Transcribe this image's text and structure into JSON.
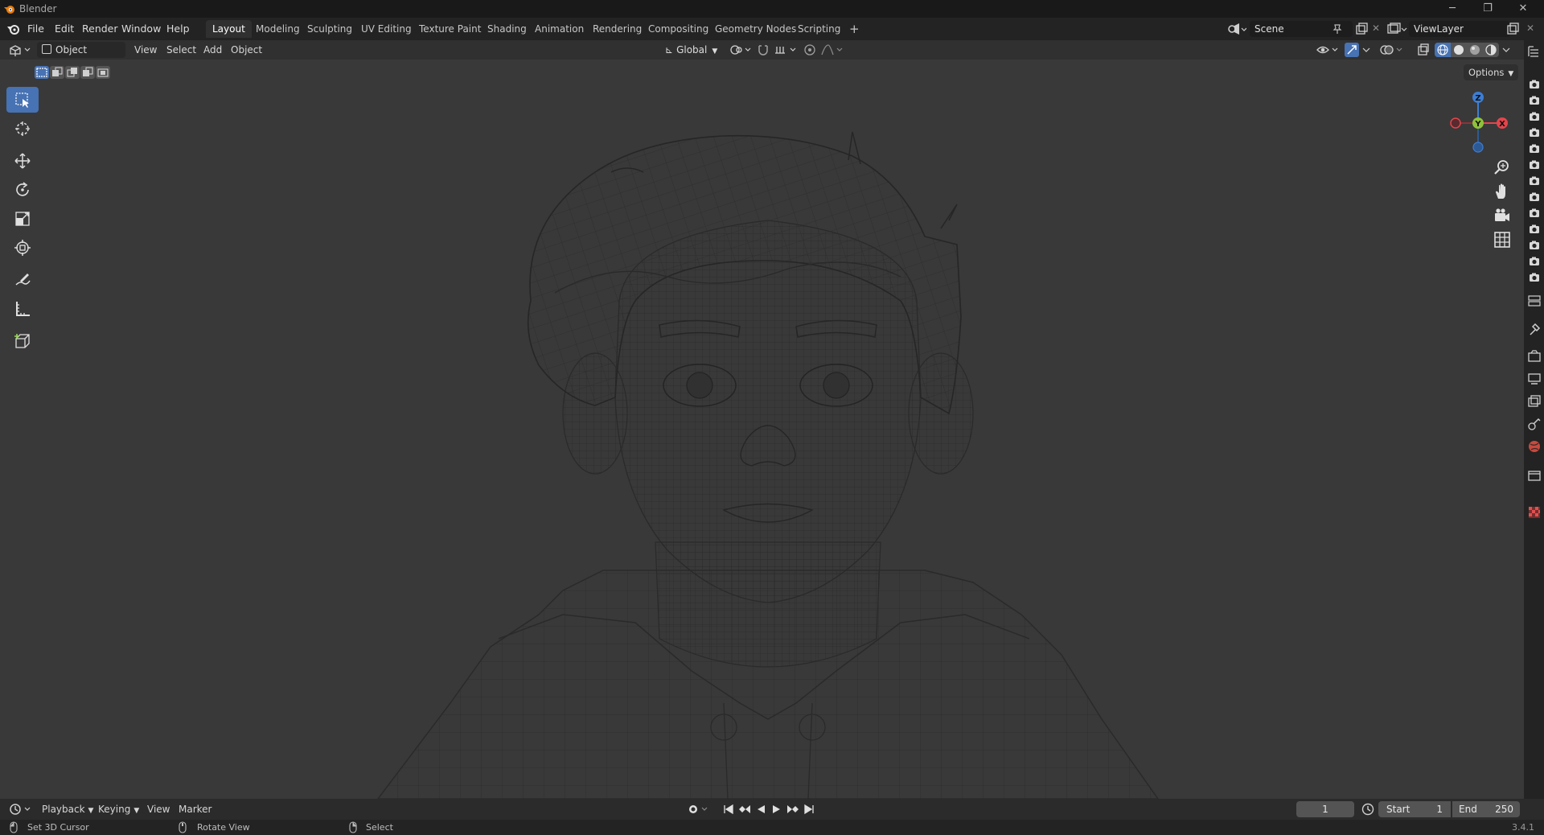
{
  "window": {
    "title": "Blender",
    "controls": [
      "minimize-icon",
      "restore-icon",
      "close-icon"
    ]
  },
  "menu": {
    "items": [
      "File",
      "Edit",
      "Render",
      "Window",
      "Help"
    ]
  },
  "workspaces": {
    "tabs": [
      "Layout",
      "Modeling",
      "Sculpting",
      "UV Editing",
      "Texture Paint",
      "Shading",
      "Animation",
      "Rendering",
      "Compositing",
      "Geometry Nodes",
      "Scripting"
    ],
    "active": "Layout",
    "add_label": "+"
  },
  "scene": {
    "name": "Scene",
    "view_layer": "ViewLayer"
  },
  "viewport_header": {
    "mode": "Object Mode",
    "menus": [
      "View",
      "Select",
      "Add",
      "Object"
    ],
    "orientation": "Global",
    "options_label": "Options"
  },
  "gizmo": {
    "z": "Z",
    "y": "Y",
    "x": "X"
  },
  "timeline": {
    "menus": [
      "Playback",
      "Keying",
      "View",
      "Marker"
    ],
    "current_frame": "1",
    "start_label": "Start",
    "start_value": "1",
    "end_label": "End",
    "end_value": "250"
  },
  "statusbar": {
    "left": "Set 3D Cursor",
    "middle": "Rotate View",
    "right": "Select",
    "version": "3.4.1"
  },
  "colors": {
    "accent": "#4772b3",
    "viewport": "#393939",
    "gizmo_x": "#e4454c",
    "gizmo_y": "#8fc13b",
    "gizmo_z": "#3d7ed4"
  }
}
